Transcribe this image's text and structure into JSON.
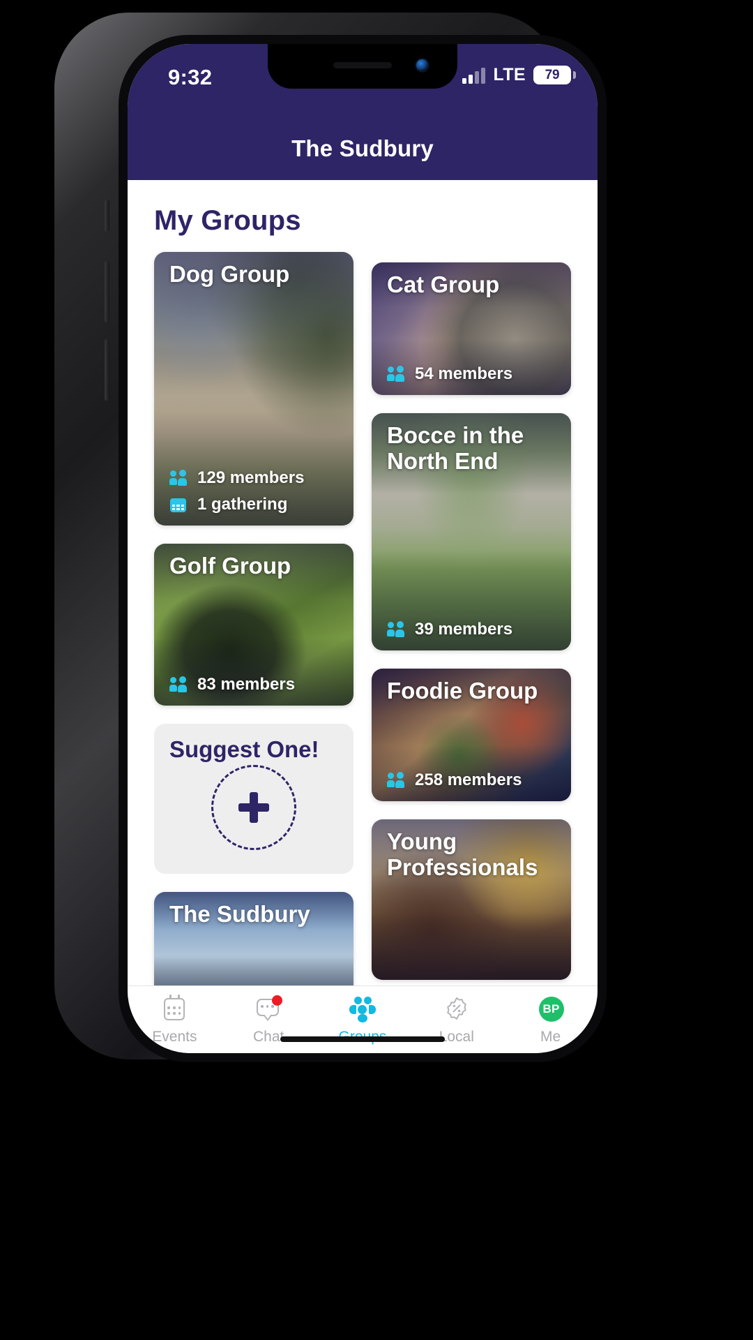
{
  "status_bar": {
    "time": "9:32",
    "network": "LTE",
    "battery_percent": "79",
    "signal_icon": "cellular-signal-icon",
    "battery_icon": "battery-icon"
  },
  "header": {
    "title": "The Sudbury"
  },
  "page": {
    "title": "My Groups"
  },
  "colors": {
    "brand_purple": "#2d2566",
    "accent_cyan": "#12b9e0",
    "card_icon_cyan": "#29c6e8",
    "badge_red": "#ed1c24",
    "avatar_green": "#1fbf6a",
    "muted_grey": "#a9a9ad"
  },
  "groups": {
    "left_column": [
      {
        "name": "Dog Group",
        "members": "129 members",
        "gatherings": "1 gathering",
        "members_icon": "people-icon",
        "gathering_icon": "calendar-icon"
      },
      {
        "name": "Golf Group",
        "members": "83 members",
        "members_icon": "people-icon"
      },
      {
        "name": "The Sudbury",
        "members": "",
        "members_icon": "people-icon"
      }
    ],
    "right_column": [
      {
        "name": "Cat Group",
        "members": "54 members",
        "members_icon": "people-icon"
      },
      {
        "name": "Bocce in the North End",
        "members": "39 members",
        "members_icon": "people-icon"
      },
      {
        "name": "Foodie Group",
        "members": "258 members",
        "members_icon": "people-icon"
      },
      {
        "name": "Young Professionals",
        "members": "",
        "members_icon": "people-icon"
      }
    ]
  },
  "suggest_card": {
    "title": "Suggest One!",
    "add_icon": "plus-icon"
  },
  "tab_bar": {
    "items": [
      {
        "label": "Events",
        "icon": "calendar-icon",
        "active": false,
        "badge": ""
      },
      {
        "label": "Chat",
        "icon": "chat-bubble-icon",
        "active": false,
        "badge": "notification-dot"
      },
      {
        "label": "Groups",
        "icon": "groups-icon",
        "active": true,
        "badge": ""
      },
      {
        "label": "Local",
        "icon": "discount-tag-icon",
        "active": false,
        "badge": ""
      },
      {
        "label": "Me",
        "icon": "avatar-icon",
        "active": false,
        "badge": "",
        "initials": "BP"
      }
    ]
  }
}
